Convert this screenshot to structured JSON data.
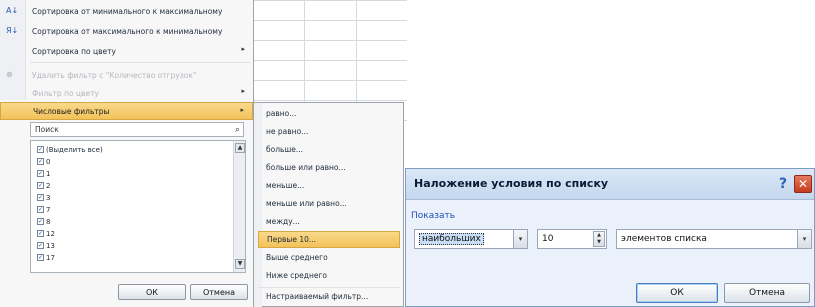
{
  "menu": {
    "items": [
      {
        "icon": "А↓",
        "label": "Сортировка от минимального к максимальному",
        "arrow": "",
        "state": "normal"
      },
      {
        "icon": "Я↓",
        "label": "Сортировка от максимального к минимальному",
        "arrow": "",
        "state": "normal"
      },
      {
        "icon": "",
        "label": "Сортировка по цвету",
        "arrow": "▸",
        "state": "normal"
      },
      {
        "icon": "⊗",
        "label": "Удалить фильтр с \"Количество отгрузок\"",
        "arrow": "",
        "state": "disabled"
      },
      {
        "icon": "",
        "label": "Фильтр по цвету",
        "arrow": "▸",
        "state": "disabled"
      },
      {
        "icon": "",
        "label": "Числовые фильтры",
        "arrow": "▸",
        "state": "active"
      }
    ],
    "search_placeholder": "Поиск",
    "list": [
      {
        "label": "(Выделить все)",
        "checked": "✓"
      },
      {
        "label": "0",
        "checked": "✓"
      },
      {
        "label": "1",
        "checked": "✓"
      },
      {
        "label": "2",
        "checked": "✓"
      },
      {
        "label": "3",
        "checked": "✓"
      },
      {
        "label": "7",
        "checked": "✓"
      },
      {
        "label": "8",
        "checked": "✓"
      },
      {
        "label": "12",
        "checked": "✓"
      },
      {
        "label": "13",
        "checked": "✓"
      },
      {
        "label": "17",
        "checked": "✓"
      }
    ],
    "ok_label": "ОК",
    "cancel_label": "Отмена"
  },
  "submenu": {
    "items": [
      {
        "label": "равно...",
        "state": "normal"
      },
      {
        "label": "не равно...",
        "state": "normal"
      },
      {
        "label": "больше...",
        "state": "normal"
      },
      {
        "label": "больше или равно...",
        "state": "normal"
      },
      {
        "label": "меньше...",
        "state": "normal"
      },
      {
        "label": "меньше или равно...",
        "state": "normal"
      },
      {
        "label": "между...",
        "state": "normal"
      },
      {
        "label": "Первые 10...",
        "state": "active"
      },
      {
        "label": "Выше среднего",
        "state": "normal"
      },
      {
        "label": "Ниже среднего",
        "state": "normal"
      },
      {
        "label": "Настраиваемый фильтр...",
        "state": "last"
      }
    ]
  },
  "dialog": {
    "title": "Наложение условия по списку",
    "help": "?",
    "close": "✕",
    "show_label": "Показать",
    "mode_value": "наибольших",
    "count_value": "10",
    "unit_value": "элементов списка",
    "ok_label": "ОК",
    "cancel_label": "Отмена"
  },
  "icons": {
    "dropdown": "▾",
    "search": "⌕",
    "scroll_up": "▲",
    "scroll_down": "▼",
    "spin_up": "▲",
    "spin_down": "▼"
  }
}
